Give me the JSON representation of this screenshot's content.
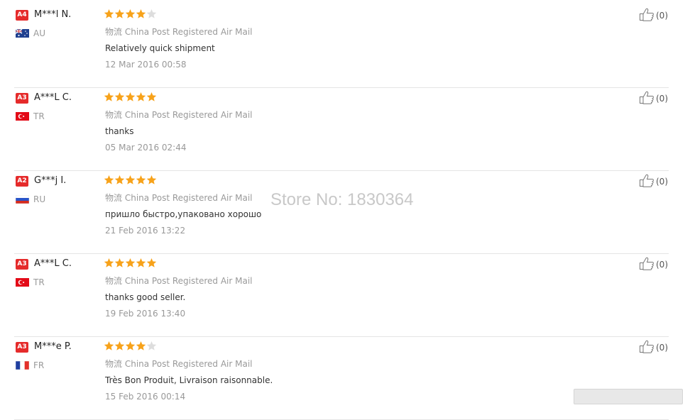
{
  "reviews": [
    {
      "level": "A4",
      "name": "M***l N.",
      "country": "AU",
      "rating": 4,
      "shipping_label": "物流",
      "shipping": "China Post Registered Air Mail",
      "comment": "Relatively quick shipment",
      "date": "12 Mar 2016 00:58",
      "likes": "(0)"
    },
    {
      "level": "A3",
      "name": "A***L C.",
      "country": "TR",
      "rating": 5,
      "shipping_label": "物流",
      "shipping": "China Post Registered Air Mail",
      "comment": "thanks",
      "date": "05 Mar 2016 02:44",
      "likes": "(0)"
    },
    {
      "level": "A2",
      "name": "G***j I.",
      "country": "RU",
      "rating": 5,
      "shipping_label": "物流",
      "shipping": "China Post Registered Air Mail",
      "comment": "пришло быстро,упаковано хорошо",
      "date": "21 Feb 2016 13:22",
      "likes": "(0)"
    },
    {
      "level": "A3",
      "name": "A***L C.",
      "country": "TR",
      "rating": 5,
      "shipping_label": "物流",
      "shipping": "China Post Registered Air Mail",
      "comment": "thanks good seller.",
      "date": "19 Feb 2016 13:40",
      "likes": "(0)"
    },
    {
      "level": "A3",
      "name": "M***e P.",
      "country": "FR",
      "rating": 4,
      "shipping_label": "物流",
      "shipping": "China Post Registered Air Mail",
      "comment": "Très Bon Produit, Livraison raisonnable.",
      "date": "15 Feb 2016 00:14",
      "likes": "(0)"
    }
  ],
  "watermark": "Store No: 1830364",
  "icons": {
    "like": "thumbs-up-icon",
    "star": "star-icon"
  },
  "colors": {
    "star_filled": "#f7a21a",
    "star_empty": "#dddddd",
    "badge": "#e52b2b"
  }
}
